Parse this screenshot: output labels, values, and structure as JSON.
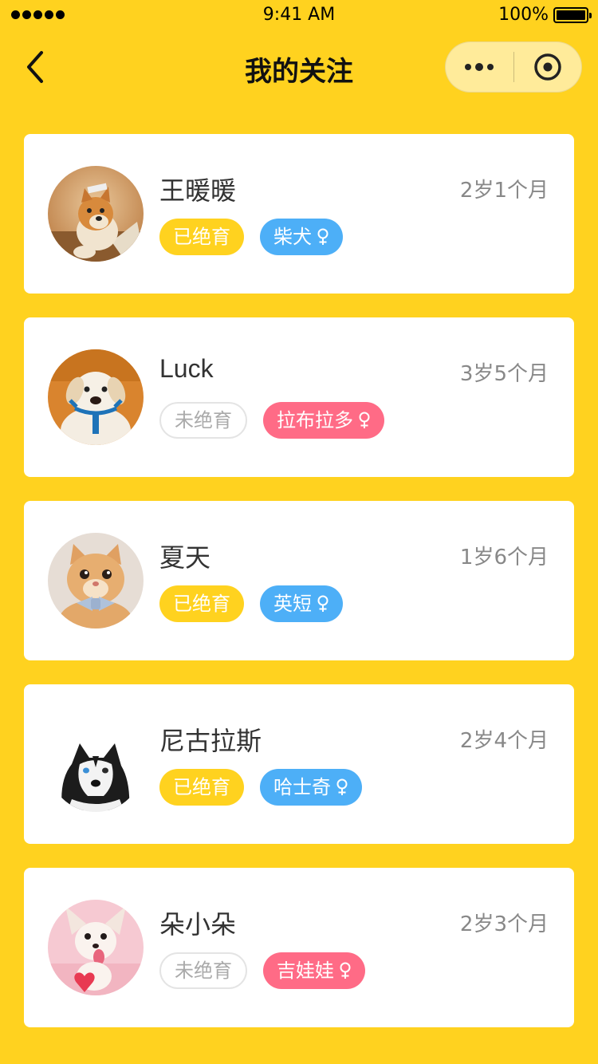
{
  "status_bar": {
    "time": "9:41 AM",
    "battery": "100%"
  },
  "nav": {
    "title": "我的关注"
  },
  "colors": {
    "background": "#FFD21F",
    "blue_tag": "#4DAFF7",
    "pink_tag": "#FF6B86",
    "neutered_tag": "#FFD21F"
  },
  "pets": [
    {
      "name": "王暖暖",
      "age": "2岁1个月",
      "neutered": "已绝育",
      "breed": "柴犬",
      "gender_icon": "female-icon",
      "avatar": "shiba-dog-photo"
    },
    {
      "name": "Luck",
      "age": "3岁5个月",
      "neutered": "未绝育",
      "breed": "拉布拉多",
      "gender_icon": "female-icon",
      "avatar": "labrador-dog-photo"
    },
    {
      "name": "夏天",
      "age": "1岁6个月",
      "neutered": "已绝育",
      "breed": "英短",
      "gender_icon": "female-icon",
      "avatar": "british-shorthair-cat-photo"
    },
    {
      "name": "尼古拉斯",
      "age": "2岁4个月",
      "neutered": "已绝育",
      "breed": "哈士奇",
      "gender_icon": "female-icon",
      "avatar": "husky-dog-photo"
    },
    {
      "name": "朵小朵",
      "age": "2岁3个月",
      "neutered": "未绝育",
      "breed": "吉娃娃",
      "gender_icon": "female-icon",
      "avatar": "chihuahua-dog-photo"
    }
  ]
}
